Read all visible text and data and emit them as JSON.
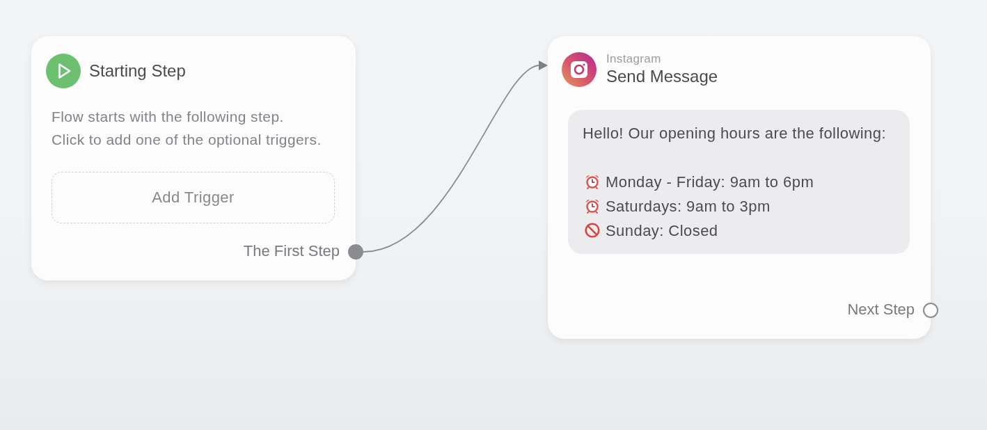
{
  "nodes": [
    {
      "kind": "start",
      "title": "Starting Step",
      "description": [
        "Flow starts with the following step.",
        "Click to add one of the optional triggers."
      ],
      "action": "Add Trigger",
      "output": {
        "label": "The First Step",
        "connected": true
      }
    },
    {
      "kind": "message",
      "channel": "Instagram",
      "title": "Send Message",
      "message": {
        "greeting": "Hello! Our opening hours are the following:",
        "lines": [
          {
            "kind": "clock",
            "text": "Monday - Friday: 9am to 6pm"
          },
          {
            "kind": "clock",
            "text": "Saturdays: 9am to 3pm"
          },
          {
            "kind": "prohibited",
            "text": "Sunday: Closed"
          }
        ]
      },
      "output": {
        "label": "Next Step",
        "connected": false
      }
    }
  ]
}
